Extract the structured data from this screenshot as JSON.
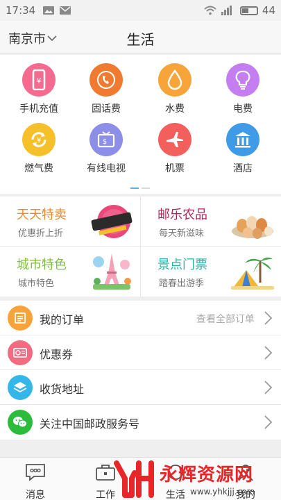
{
  "status_bar": {
    "time": "17:34",
    "battery_level": "44",
    "icons": [
      "image-icon",
      "mail-icon",
      "wifi-icon",
      "signal-icon",
      "battery-icon"
    ]
  },
  "header": {
    "city": "南京市",
    "title": "生活"
  },
  "services": [
    {
      "label": "手机充值",
      "icon": "mobile-topup-icon",
      "color": "#f56a8f"
    },
    {
      "label": "固话费",
      "icon": "phone-icon",
      "color": "#f07a2f"
    },
    {
      "label": "水费",
      "icon": "water-drop-icon",
      "color": "#f7a43b"
    },
    {
      "label": "电费",
      "icon": "lightbulb-icon",
      "color": "#c57ef0"
    },
    {
      "label": "燃气费",
      "icon": "gas-icon",
      "color": "#f6c02a"
    },
    {
      "label": "有线电视",
      "icon": "tv-icon",
      "color": "#8c8ee8"
    },
    {
      "label": "机票",
      "icon": "airplane-icon",
      "color": "#f25f5c"
    },
    {
      "label": "酒店",
      "icon": "hotel-icon",
      "color": "#3f9ae8"
    }
  ],
  "pager": {
    "pages": 2,
    "active": 0
  },
  "promos": [
    {
      "title": "天天特卖",
      "subtitle": "优惠折上折",
      "color": "#f08a2a",
      "art_text": "天天特卖"
    },
    {
      "title": "邮乐农品",
      "subtitle": "每天新滋味",
      "color": "#b0285a"
    },
    {
      "title": "城市特色",
      "subtitle": "城市特色",
      "color": "#7dbf3a"
    },
    {
      "title": "景点门票",
      "subtitle": "踏春出游季",
      "color": "#26b3a3"
    }
  ],
  "menu": [
    {
      "label": "我的订单",
      "right": "查看全部订单",
      "icon": "order-list-icon",
      "color": "#f6a33c"
    },
    {
      "label": "优惠券",
      "right": "",
      "icon": "coupon-icon",
      "color": "#f26b80"
    },
    {
      "label": "收货地址",
      "right": "",
      "icon": "address-layers-icon",
      "color": "#35b6ea"
    },
    {
      "label": "关注中国邮政服务号",
      "right": "",
      "icon": "wechat-icon",
      "color": "#2dbb3c"
    }
  ],
  "tabs": [
    {
      "label": "消息",
      "icon": "message-icon"
    },
    {
      "label": "工作",
      "icon": "briefcase-icon"
    },
    {
      "label": "生活",
      "icon": "life-icon"
    },
    {
      "label": "我的",
      "icon": "profile-icon"
    }
  ],
  "watermark": {
    "text": "永辉资源网",
    "url": "www.yhkjjj.com"
  }
}
